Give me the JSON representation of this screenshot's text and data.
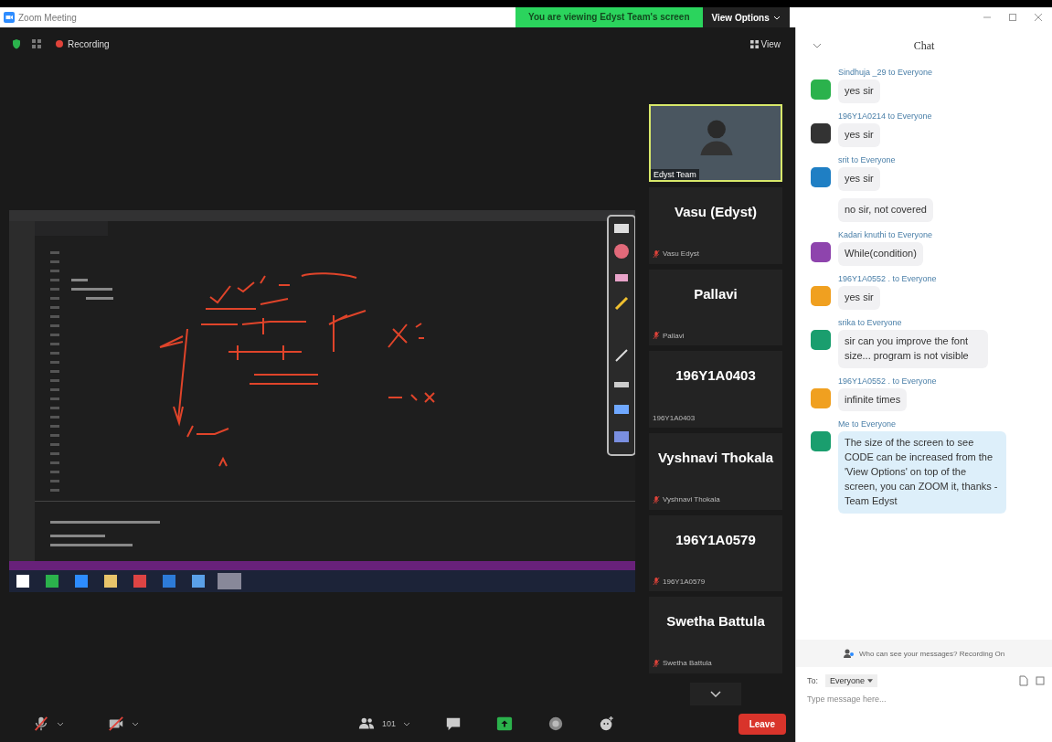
{
  "window": {
    "title": "Zoom Meeting",
    "banner": "You are viewing Edyst Team's screen",
    "view_options": "View Options"
  },
  "meeting_bar": {
    "recording": "Recording",
    "view": "View"
  },
  "participants": [
    {
      "kind": "video",
      "label": "Edyst Team",
      "speaking": true
    },
    {
      "kind": "name",
      "name": "Vasu (Edyst)",
      "label": "Vasu Edyst",
      "muted": true,
      "speaking": false
    },
    {
      "kind": "name",
      "name": "Pallavi",
      "label": "Pallavi",
      "muted": true,
      "speaking": false
    },
    {
      "kind": "name",
      "name": "196Y1A0403",
      "label": "196Y1A0403",
      "muted": false,
      "speaking": false
    },
    {
      "kind": "name",
      "name": "Vyshnavi Thokala",
      "label": "Vyshnavi Thokala",
      "muted": true,
      "speaking": false
    },
    {
      "kind": "name",
      "name": "196Y1A0579",
      "label": "196Y1A0579",
      "muted": true,
      "speaking": false
    },
    {
      "kind": "name",
      "name": "Swetha Battula",
      "label": "Swetha Battula",
      "muted": true,
      "speaking": false
    }
  ],
  "toolbar": {
    "participant_count": "101",
    "leave": "Leave"
  },
  "chat": {
    "title": "Chat",
    "messages": [
      {
        "sender": "Sindhuja _29 to Everyone",
        "kind": "color",
        "color": "#2bb24c",
        "mine": false,
        "texts": [
          "yes sir"
        ]
      },
      {
        "sender": "196Y1A0214 to Everyone",
        "kind": "photo",
        "mine": false,
        "texts": [
          "yes sir"
        ]
      },
      {
        "sender": "srit to Everyone",
        "kind": "color",
        "color": "#1f7fc4",
        "mine": false,
        "texts": [
          "yes sir",
          "no sir, not covered"
        ]
      },
      {
        "sender": "Kadari knuthi to Everyone",
        "kind": "color",
        "color": "#8e44ad",
        "mine": false,
        "texts": [
          "While(condition)"
        ]
      },
      {
        "sender": "196Y1A0552 . to Everyone",
        "kind": "color",
        "color": "#f0a020",
        "mine": false,
        "texts": [
          "yes sir"
        ]
      },
      {
        "sender": "srika to Everyone",
        "kind": "color",
        "color": "#1a9e6e",
        "mine": false,
        "texts": [
          "sir can you improve the font size... program is not visible"
        ]
      },
      {
        "sender": "196Y1A0552 . to Everyone",
        "kind": "color",
        "color": "#f0a020",
        "mine": false,
        "texts": [
          "infinite  times"
        ]
      },
      {
        "sender": "Me to Everyone",
        "kind": "color",
        "color": "#1a9e6e",
        "mine": true,
        "texts": [
          "The size of the screen to see CODE can be increased from the 'View Options' on top of the screen, you can ZOOM it, thanks - Team Edyst"
        ]
      }
    ],
    "notice": "Who can see your messages? Recording On",
    "to_label": "To:",
    "recipient": "Everyone",
    "placeholder": "Type message here..."
  }
}
